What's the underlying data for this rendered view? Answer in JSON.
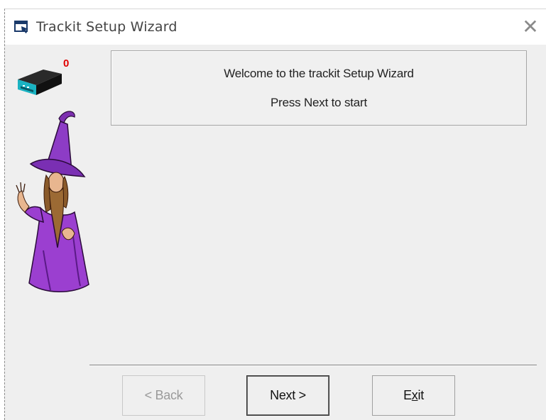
{
  "window": {
    "title": "Trackit Setup Wizard",
    "close_glyph": "✕"
  },
  "status": {
    "device_count": "0",
    "device_icon": "hub-device-icon",
    "device_count_color": "#e00000"
  },
  "welcome": {
    "title": "Welcome to the trackit Setup Wizard",
    "subtitle": "Press Next to start"
  },
  "buttons": {
    "back_label": "< Back",
    "next_label": "Next >",
    "exit_label_pre": "E",
    "exit_label_mnemonic": "x",
    "exit_label_post": "it",
    "back_enabled": false
  },
  "colors": {
    "window_bg": "#efefef",
    "wizard_robe": "#9b3fd0"
  }
}
